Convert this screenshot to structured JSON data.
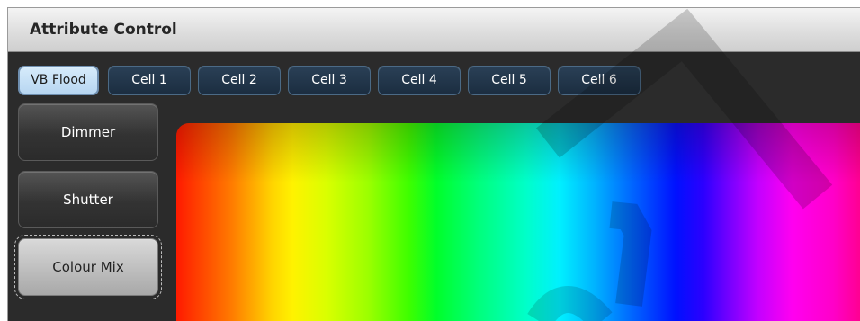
{
  "window": {
    "title": "Attribute Control"
  },
  "tabs": [
    {
      "label": "VB Flood",
      "active": true
    },
    {
      "label": "Cell 1",
      "active": false
    },
    {
      "label": "Cell 2",
      "active": false
    },
    {
      "label": "Cell 3",
      "active": false
    },
    {
      "label": "Cell 4",
      "active": false
    },
    {
      "label": "Cell 5",
      "active": false
    },
    {
      "label": "Cell 6",
      "active": false
    }
  ],
  "attributes": [
    {
      "label": "Dimmer",
      "active": false
    },
    {
      "label": "Shutter",
      "active": false
    },
    {
      "label": "Colour Mix",
      "active": true
    }
  ],
  "colors": {
    "tab_active_bg": "#c7e1f7",
    "tab_bg": "#22364a",
    "panel_bg": "#2b2b2b"
  }
}
